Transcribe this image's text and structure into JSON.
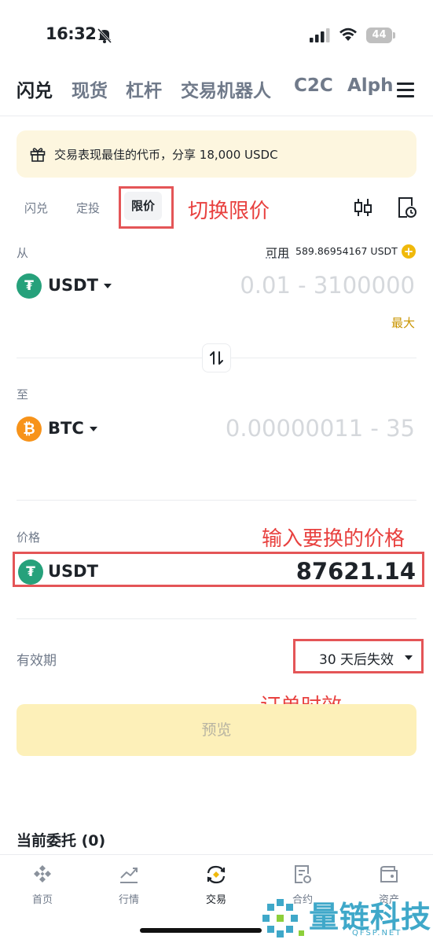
{
  "status_bar": {
    "time": "16:32",
    "battery": "44"
  },
  "top_tabs": [
    "闪兑",
    "现货",
    "杠杆",
    "交易机器人",
    "C2C",
    "Alph"
  ],
  "promo": {
    "text": "交易表现最佳的代币，分享 18,000 USDC"
  },
  "mode_tabs": {
    "swap": "闪兑",
    "recurring": "定投",
    "limit": "限价"
  },
  "annotations": {
    "switch_limit": "切换限价",
    "enter_price": "输入要换的价格",
    "order_validity": "订单时效"
  },
  "from": {
    "label": "从",
    "available_label": "可用",
    "available_value": "589.86954167 USDT",
    "coin": "USDT",
    "placeholder": "0.01 - 3100000",
    "max_label": "最大"
  },
  "to": {
    "label": "至",
    "coin": "BTC",
    "placeholder": "0.00000011 - 35"
  },
  "price": {
    "label": "价格",
    "coin": "USDT",
    "value": "87621.14"
  },
  "validity": {
    "label": "有效期",
    "selected": "30 天后失效"
  },
  "preview_button": "预览",
  "orders": {
    "title": "当前委托 (0)"
  },
  "bottom_nav": {
    "home": "首页",
    "markets": "行情",
    "trade": "交易",
    "futures": "合约",
    "assets": "资产"
  },
  "watermark": {
    "name": "量链科技",
    "domain": "QFSP.NET"
  },
  "colors": {
    "brand_yellow": "#f0b90b",
    "tether_green": "#26a17b",
    "bitcoin_orange": "#f7931a",
    "annotation_red": "#e45557",
    "watermark_blue": "#3fa8c9"
  }
}
